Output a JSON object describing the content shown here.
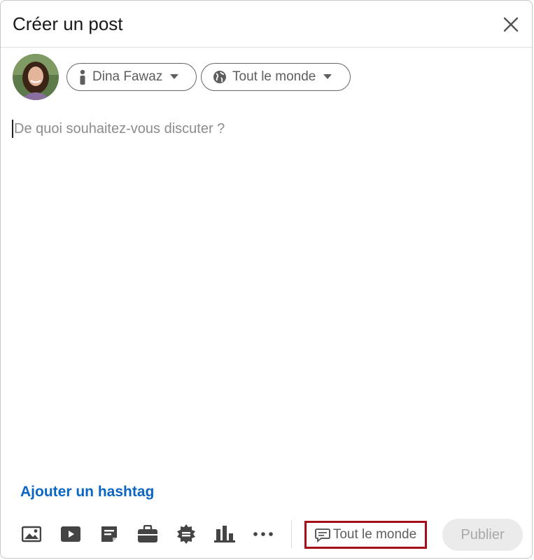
{
  "dialog": {
    "title": "Créer un post"
  },
  "author": {
    "name": "Dina Fawaz"
  },
  "audience": {
    "label": "Tout le monde"
  },
  "editor": {
    "placeholder": "De quoi souhaitez-vous discuter ?"
  },
  "hashtag_link": "Ajouter un hashtag",
  "toolbar": {
    "icons": [
      "image-icon",
      "video-icon",
      "document-icon",
      "job-icon",
      "celebrate-icon",
      "poll-icon",
      "more-icon"
    ],
    "comment_control_label": "Tout le monde",
    "publish_label": "Publier"
  },
  "colors": {
    "accent": "#0a66c2",
    "highlight_border": "#a50e17",
    "icon": "#444444"
  }
}
